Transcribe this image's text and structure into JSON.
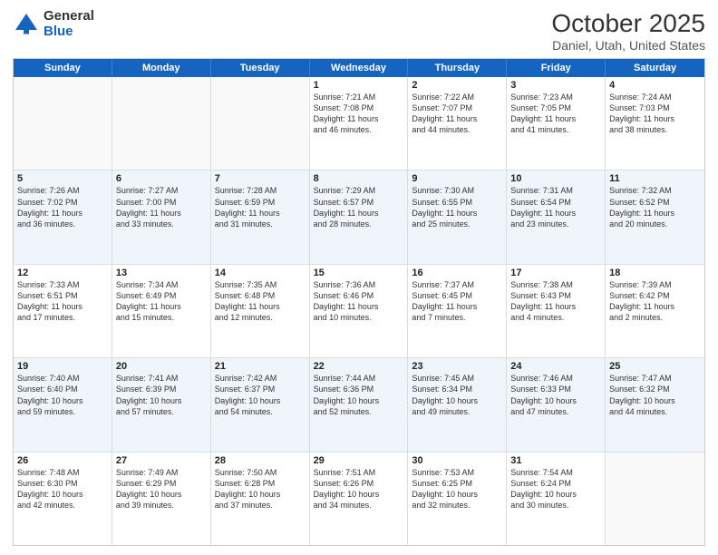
{
  "logo": {
    "general": "General",
    "blue": "Blue"
  },
  "title": {
    "month": "October 2025",
    "location": "Daniel, Utah, United States"
  },
  "calendar": {
    "headers": [
      "Sunday",
      "Monday",
      "Tuesday",
      "Wednesday",
      "Thursday",
      "Friday",
      "Saturday"
    ],
    "rows": [
      [
        {
          "day": "",
          "info": ""
        },
        {
          "day": "",
          "info": ""
        },
        {
          "day": "",
          "info": ""
        },
        {
          "day": "1",
          "info": "Sunrise: 7:21 AM\nSunset: 7:08 PM\nDaylight: 11 hours\nand 46 minutes."
        },
        {
          "day": "2",
          "info": "Sunrise: 7:22 AM\nSunset: 7:07 PM\nDaylight: 11 hours\nand 44 minutes."
        },
        {
          "day": "3",
          "info": "Sunrise: 7:23 AM\nSunset: 7:05 PM\nDaylight: 11 hours\nand 41 minutes."
        },
        {
          "day": "4",
          "info": "Sunrise: 7:24 AM\nSunset: 7:03 PM\nDaylight: 11 hours\nand 38 minutes."
        }
      ],
      [
        {
          "day": "5",
          "info": "Sunrise: 7:26 AM\nSunset: 7:02 PM\nDaylight: 11 hours\nand 36 minutes."
        },
        {
          "day": "6",
          "info": "Sunrise: 7:27 AM\nSunset: 7:00 PM\nDaylight: 11 hours\nand 33 minutes."
        },
        {
          "day": "7",
          "info": "Sunrise: 7:28 AM\nSunset: 6:59 PM\nDaylight: 11 hours\nand 31 minutes."
        },
        {
          "day": "8",
          "info": "Sunrise: 7:29 AM\nSunset: 6:57 PM\nDaylight: 11 hours\nand 28 minutes."
        },
        {
          "day": "9",
          "info": "Sunrise: 7:30 AM\nSunset: 6:55 PM\nDaylight: 11 hours\nand 25 minutes."
        },
        {
          "day": "10",
          "info": "Sunrise: 7:31 AM\nSunset: 6:54 PM\nDaylight: 11 hours\nand 23 minutes."
        },
        {
          "day": "11",
          "info": "Sunrise: 7:32 AM\nSunset: 6:52 PM\nDaylight: 11 hours\nand 20 minutes."
        }
      ],
      [
        {
          "day": "12",
          "info": "Sunrise: 7:33 AM\nSunset: 6:51 PM\nDaylight: 11 hours\nand 17 minutes."
        },
        {
          "day": "13",
          "info": "Sunrise: 7:34 AM\nSunset: 6:49 PM\nDaylight: 11 hours\nand 15 minutes."
        },
        {
          "day": "14",
          "info": "Sunrise: 7:35 AM\nSunset: 6:48 PM\nDaylight: 11 hours\nand 12 minutes."
        },
        {
          "day": "15",
          "info": "Sunrise: 7:36 AM\nSunset: 6:46 PM\nDaylight: 11 hours\nand 10 minutes."
        },
        {
          "day": "16",
          "info": "Sunrise: 7:37 AM\nSunset: 6:45 PM\nDaylight: 11 hours\nand 7 minutes."
        },
        {
          "day": "17",
          "info": "Sunrise: 7:38 AM\nSunset: 6:43 PM\nDaylight: 11 hours\nand 4 minutes."
        },
        {
          "day": "18",
          "info": "Sunrise: 7:39 AM\nSunset: 6:42 PM\nDaylight: 11 hours\nand 2 minutes."
        }
      ],
      [
        {
          "day": "19",
          "info": "Sunrise: 7:40 AM\nSunset: 6:40 PM\nDaylight: 10 hours\nand 59 minutes."
        },
        {
          "day": "20",
          "info": "Sunrise: 7:41 AM\nSunset: 6:39 PM\nDaylight: 10 hours\nand 57 minutes."
        },
        {
          "day": "21",
          "info": "Sunrise: 7:42 AM\nSunset: 6:37 PM\nDaylight: 10 hours\nand 54 minutes."
        },
        {
          "day": "22",
          "info": "Sunrise: 7:44 AM\nSunset: 6:36 PM\nDaylight: 10 hours\nand 52 minutes."
        },
        {
          "day": "23",
          "info": "Sunrise: 7:45 AM\nSunset: 6:34 PM\nDaylight: 10 hours\nand 49 minutes."
        },
        {
          "day": "24",
          "info": "Sunrise: 7:46 AM\nSunset: 6:33 PM\nDaylight: 10 hours\nand 47 minutes."
        },
        {
          "day": "25",
          "info": "Sunrise: 7:47 AM\nSunset: 6:32 PM\nDaylight: 10 hours\nand 44 minutes."
        }
      ],
      [
        {
          "day": "26",
          "info": "Sunrise: 7:48 AM\nSunset: 6:30 PM\nDaylight: 10 hours\nand 42 minutes."
        },
        {
          "day": "27",
          "info": "Sunrise: 7:49 AM\nSunset: 6:29 PM\nDaylight: 10 hours\nand 39 minutes."
        },
        {
          "day": "28",
          "info": "Sunrise: 7:50 AM\nSunset: 6:28 PM\nDaylight: 10 hours\nand 37 minutes."
        },
        {
          "day": "29",
          "info": "Sunrise: 7:51 AM\nSunset: 6:26 PM\nDaylight: 10 hours\nand 34 minutes."
        },
        {
          "day": "30",
          "info": "Sunrise: 7:53 AM\nSunset: 6:25 PM\nDaylight: 10 hours\nand 32 minutes."
        },
        {
          "day": "31",
          "info": "Sunrise: 7:54 AM\nSunset: 6:24 PM\nDaylight: 10 hours\nand 30 minutes."
        },
        {
          "day": "",
          "info": ""
        }
      ]
    ]
  }
}
